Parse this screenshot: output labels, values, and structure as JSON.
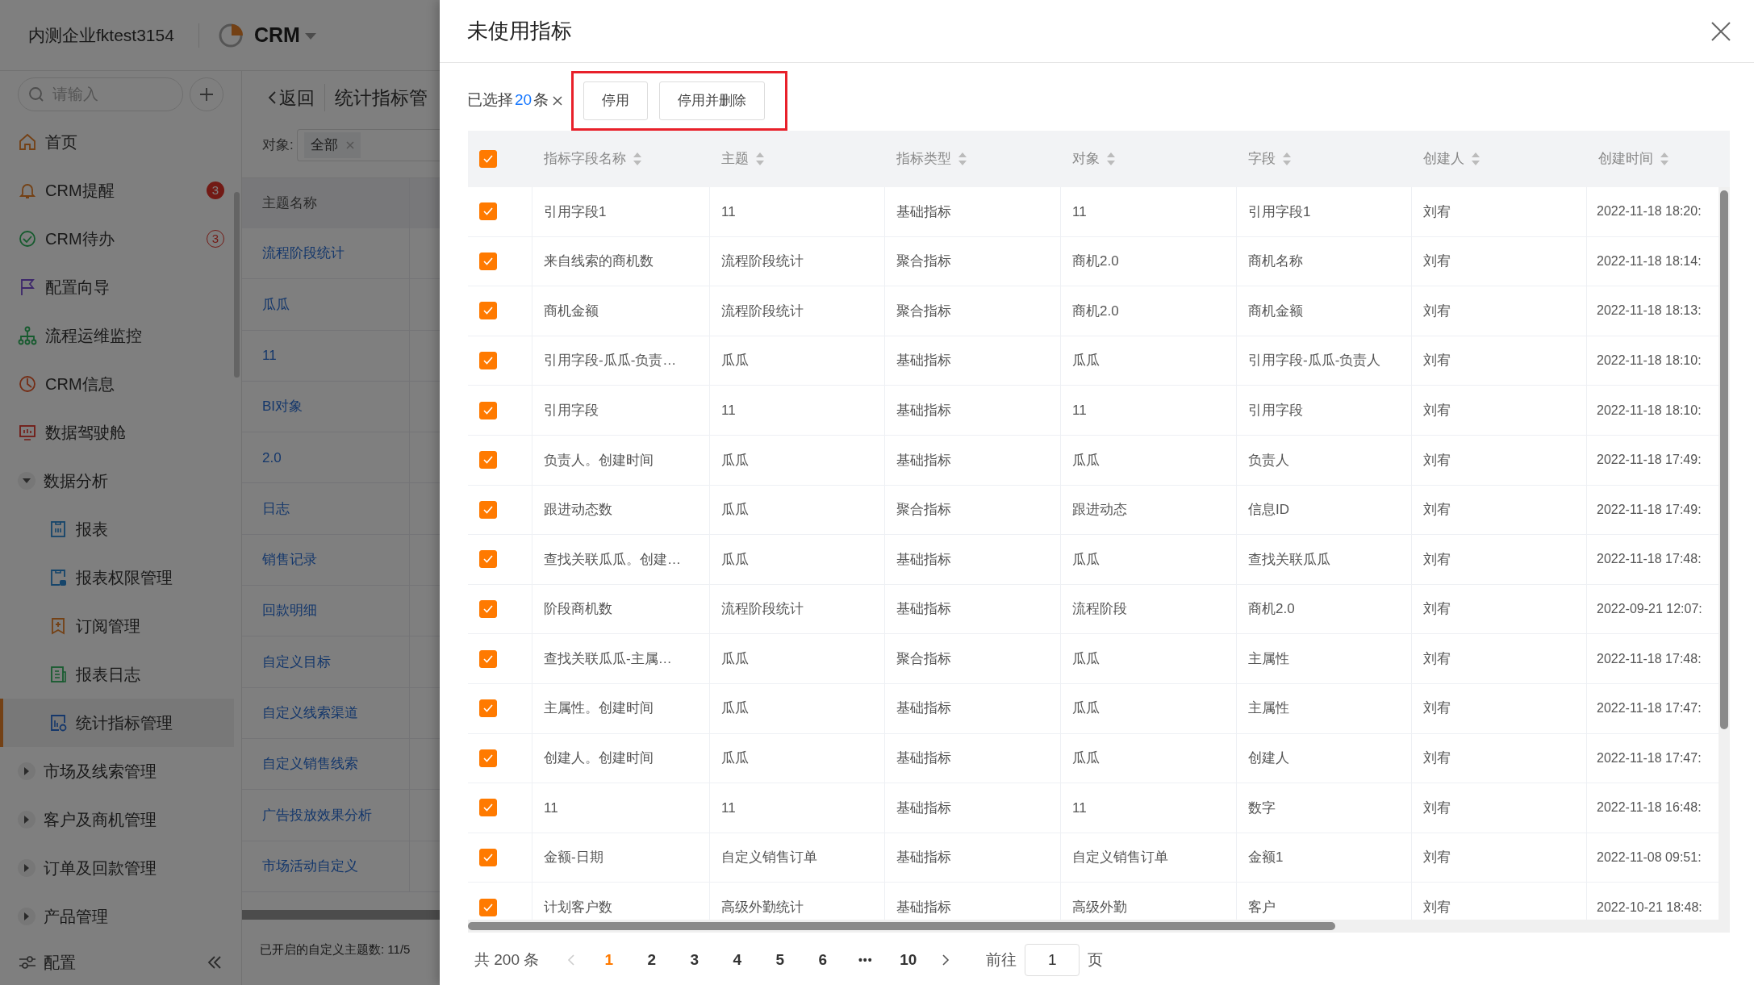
{
  "header": {
    "company": "内测企业fktest3154",
    "app": "CRM"
  },
  "sidebar": {
    "search": {
      "placeholder": "请输入"
    },
    "items": [
      {
        "label": "首页",
        "selected": false
      },
      {
        "label": "CRM提醒",
        "selected": false,
        "badge": {
          "text": "3",
          "kind": "solid"
        }
      },
      {
        "label": "CRM待办",
        "selected": false,
        "badge": {
          "text": "3",
          "kind": "outline"
        }
      },
      {
        "label": "配置向导",
        "selected": false
      },
      {
        "label": "流程运维监控",
        "selected": false
      },
      {
        "label": "CRM信息",
        "selected": false
      },
      {
        "label": "数据驾驶舱",
        "selected": false
      },
      {
        "label": "数据分析",
        "selected": false,
        "expanded": true,
        "children": [
          {
            "label": "报表",
            "selected": false
          },
          {
            "label": "报表权限管理",
            "selected": false
          },
          {
            "label": "订阅管理",
            "selected": false
          },
          {
            "label": "报表日志",
            "selected": false
          },
          {
            "label": "统计指标管理",
            "selected": true
          }
        ]
      },
      {
        "label": "市场及线索管理",
        "selected": false,
        "expanded": false
      },
      {
        "label": "客户及商机管理",
        "selected": false,
        "expanded": false
      },
      {
        "label": "订单及回款管理",
        "selected": false,
        "expanded": false
      },
      {
        "label": "产品管理",
        "selected": false,
        "expanded": false
      }
    ],
    "footer": {
      "label": "配置"
    }
  },
  "panel": {
    "back": "返回",
    "title": "统计指标管",
    "filter": {
      "label": "对象:",
      "tag": "全部"
    },
    "table": {
      "column": "主题名称",
      "rows": [
        "流程阶段统计",
        "瓜瓜",
        "11",
        "BI对象",
        "2.0",
        "日志",
        "销售记录",
        "回款明细",
        "自定义目标",
        "自定义线索渠道",
        "自定义销售线索",
        "广告投放效果分析",
        "市场活动自定义"
      ]
    },
    "footer": "已开启的自定义主题数: 11/5"
  },
  "dialog": {
    "title": "未使用指标",
    "selection": {
      "prefix": "已选择",
      "count": "20",
      "suffix": "条"
    },
    "buttons": [
      "停用",
      "停用并删除"
    ],
    "table": {
      "select_all": true,
      "columns": [
        "指标字段名称",
        "主题",
        "指标类型",
        "对象",
        "字段",
        "创建人",
        "创建时间"
      ],
      "rows": [
        {
          "checked": true,
          "cells": [
            "引用字段1",
            "11",
            "基础指标",
            "11",
            "引用字段1",
            "刘宥",
            "2022-11-18 18:20:"
          ]
        },
        {
          "checked": true,
          "cells": [
            "来自线索的商机数",
            "流程阶段统计",
            "聚合指标",
            "商机2.0",
            "商机名称",
            "刘宥",
            "2022-11-18 18:14:"
          ]
        },
        {
          "checked": true,
          "cells": [
            "商机金额",
            "流程阶段统计",
            "聚合指标",
            "商机2.0",
            "商机金额",
            "刘宥",
            "2022-11-18 18:13:"
          ]
        },
        {
          "checked": true,
          "cells": [
            "引用字段-瓜瓜-负责…",
            "瓜瓜",
            "基础指标",
            "瓜瓜",
            "引用字段-瓜瓜-负责人",
            "刘宥",
            "2022-11-18 18:10:"
          ]
        },
        {
          "checked": true,
          "cells": [
            "引用字段",
            "11",
            "基础指标",
            "11",
            "引用字段",
            "刘宥",
            "2022-11-18 18:10:"
          ]
        },
        {
          "checked": true,
          "cells": [
            "负责人。创建时间",
            "瓜瓜",
            "基础指标",
            "瓜瓜",
            "负责人",
            "刘宥",
            "2022-11-18 17:49:"
          ]
        },
        {
          "checked": true,
          "cells": [
            "跟进动态数",
            "瓜瓜",
            "聚合指标",
            "跟进动态",
            "信息ID",
            "刘宥",
            "2022-11-18 17:49:"
          ]
        },
        {
          "checked": true,
          "cells": [
            "查找关联瓜瓜。创建…",
            "瓜瓜",
            "基础指标",
            "瓜瓜",
            "查找关联瓜瓜",
            "刘宥",
            "2022-11-18 17:48:"
          ]
        },
        {
          "checked": true,
          "cells": [
            "阶段商机数",
            "流程阶段统计",
            "基础指标",
            "流程阶段",
            "商机2.0",
            "刘宥",
            "2022-09-21 12:07:"
          ]
        },
        {
          "checked": true,
          "cells": [
            "查找关联瓜瓜-主属…",
            "瓜瓜",
            "聚合指标",
            "瓜瓜",
            "主属性",
            "刘宥",
            "2022-11-18 17:48:"
          ]
        },
        {
          "checked": true,
          "cells": [
            "主属性。创建时间",
            "瓜瓜",
            "基础指标",
            "瓜瓜",
            "主属性",
            "刘宥",
            "2022-11-18 17:47:"
          ]
        },
        {
          "checked": true,
          "cells": [
            "创建人。创建时间",
            "瓜瓜",
            "基础指标",
            "瓜瓜",
            "创建人",
            "刘宥",
            "2022-11-18 17:47:"
          ]
        },
        {
          "checked": true,
          "cells": [
            "11",
            "11",
            "基础指标",
            "11",
            "数字",
            "刘宥",
            "2022-11-18 16:48:"
          ]
        },
        {
          "checked": true,
          "cells": [
            "金额-日期",
            "自定义销售订单",
            "基础指标",
            "自定义销售订单",
            "金额1",
            "刘宥",
            "2022-11-08 09:51:"
          ]
        },
        {
          "checked": true,
          "cells": [
            "计划客户数",
            "高级外勤统计",
            "基础指标",
            "高级外勤",
            "客户",
            "刘宥",
            "2022-10-21 18:48:"
          ]
        }
      ]
    },
    "pagination": {
      "total": "共 200 条",
      "prev": {
        "disabled": true
      },
      "next": {
        "disabled": false
      },
      "pages": [
        {
          "label": "1",
          "kind": "page",
          "selected": true
        },
        {
          "label": "2",
          "kind": "page",
          "selected": false
        },
        {
          "label": "3",
          "kind": "page",
          "selected": false
        },
        {
          "label": "4",
          "kind": "page",
          "selected": false
        },
        {
          "label": "5",
          "kind": "page",
          "selected": false
        },
        {
          "label": "6",
          "kind": "page",
          "selected": false
        },
        {
          "label": "•••",
          "kind": "ellipsis",
          "selected": false
        },
        {
          "label": "10",
          "kind": "page",
          "selected": false
        }
      ],
      "goto": {
        "label": "前往",
        "value": "1",
        "suffix": "页"
      }
    }
  }
}
